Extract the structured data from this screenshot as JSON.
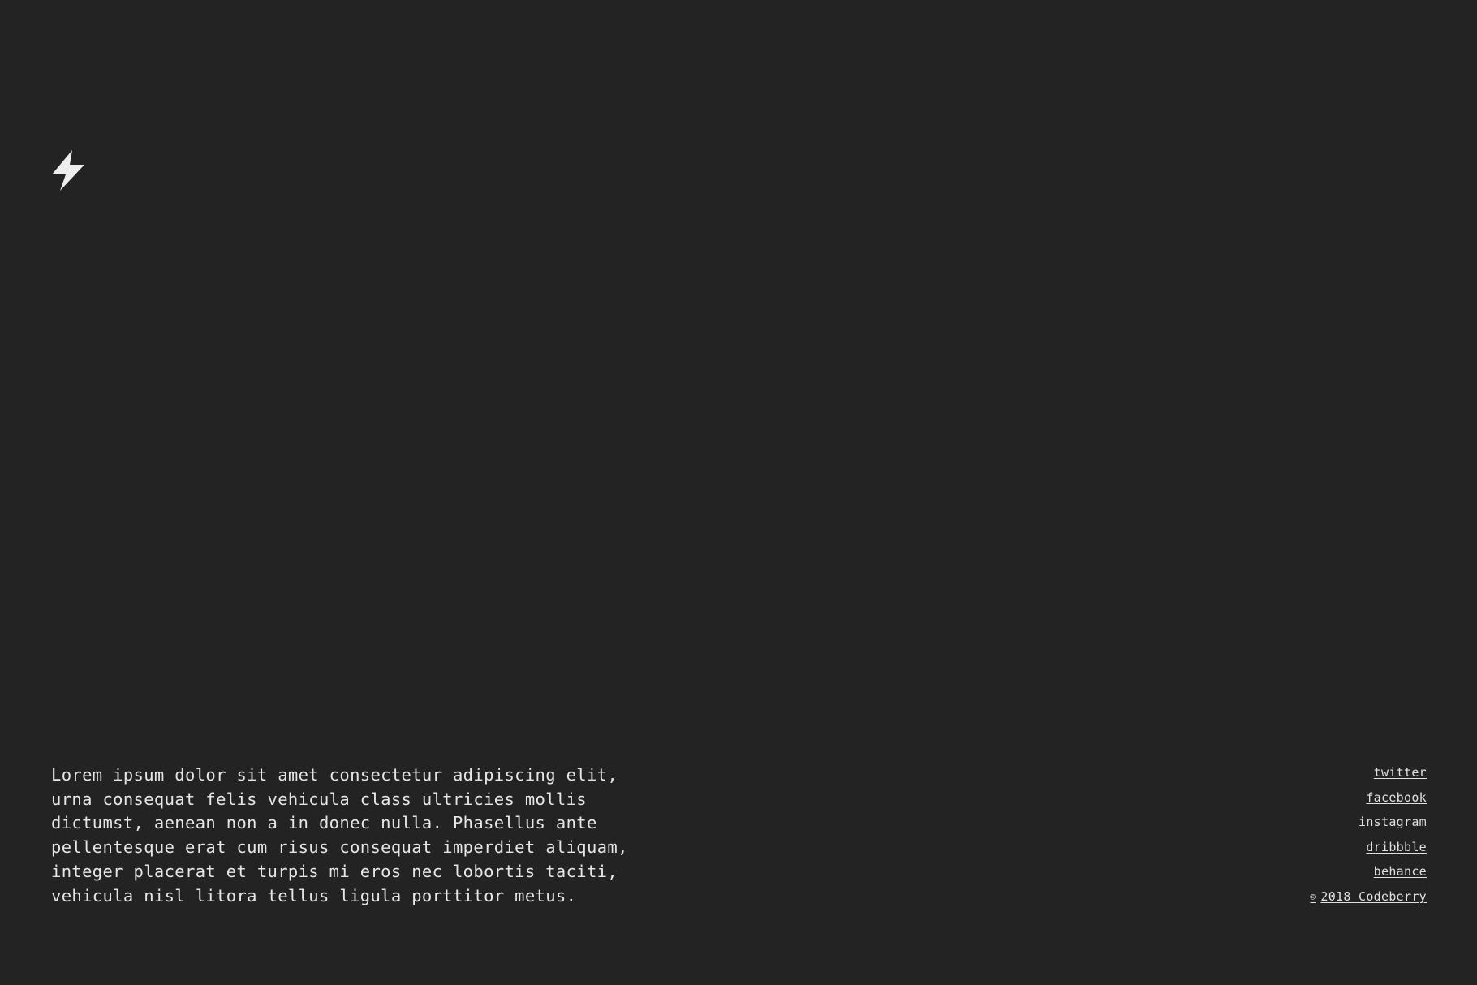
{
  "logo": {
    "icon": "lightning-bolt-icon",
    "color": "#eeeeee"
  },
  "intro": {
    "text": "Lorem ipsum dolor sit amet consectetur adipiscing elit,\nurna consequat felis vehicula class ultricies mollis\ndictumst, aenean non a in donec nulla. Phasellus ante\npellentesque erat cum risus consequat imperdiet aliquam,\ninteger placerat et turpis mi eros nec lobortis taciti,\nvehicula nisl litora tellus ligula porttitor metus."
  },
  "social": {
    "links": [
      {
        "label": "twitter"
      },
      {
        "label": "facebook"
      },
      {
        "label": "instagram"
      },
      {
        "label": "dribbble"
      },
      {
        "label": "behance"
      }
    ],
    "copyright": {
      "symbol": "©",
      "text": "2018 Codeberry"
    }
  },
  "colors": {
    "background": "#232323",
    "text": "#e8e8e8"
  }
}
